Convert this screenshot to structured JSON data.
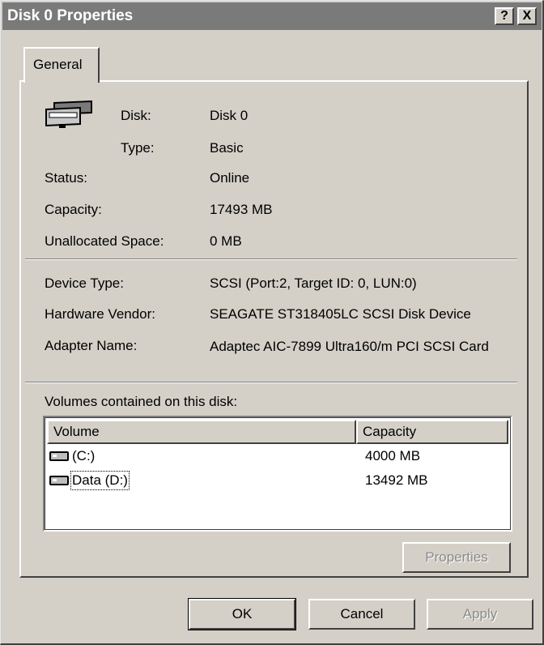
{
  "window": {
    "title": "Disk 0 Properties",
    "help_btn": "?",
    "close_btn": "X"
  },
  "tabs": [
    {
      "label": "General",
      "active": true
    }
  ],
  "general": {
    "icon": "disk-drive-icon",
    "disk_label": "Disk:",
    "disk_value": "Disk 0",
    "type_label": "Type:",
    "type_value": "Basic",
    "status_label": "Status:",
    "status_value": "Online",
    "capacity_label": "Capacity:",
    "capacity_value": "17493 MB",
    "unalloc_label": "Unallocated Space:",
    "unalloc_value": "0 MB",
    "device_type_label": "Device Type:",
    "device_type_value": "SCSI (Port:2, Target ID: 0, LUN:0)",
    "vendor_label": "Hardware Vendor:",
    "vendor_value": "SEAGATE ST318405LC SCSI Disk Device",
    "adapter_label": "Adapter Name:",
    "adapter_value": "Adaptec AIC-7899 Ultra160/m PCI SCSI Card",
    "volumes_label": "Volumes contained on this disk:"
  },
  "volumes": {
    "columns": [
      "Volume",
      "Capacity"
    ],
    "rows": [
      {
        "icon": "drive-icon",
        "volume": "(C:)",
        "capacity": "4000 MB"
      },
      {
        "icon": "drive-icon",
        "volume": "Data (D:)",
        "capacity": "13492 MB"
      }
    ],
    "properties_button": "Properties"
  },
  "footer": {
    "ok": "OK",
    "cancel": "Cancel",
    "apply": "Apply"
  }
}
